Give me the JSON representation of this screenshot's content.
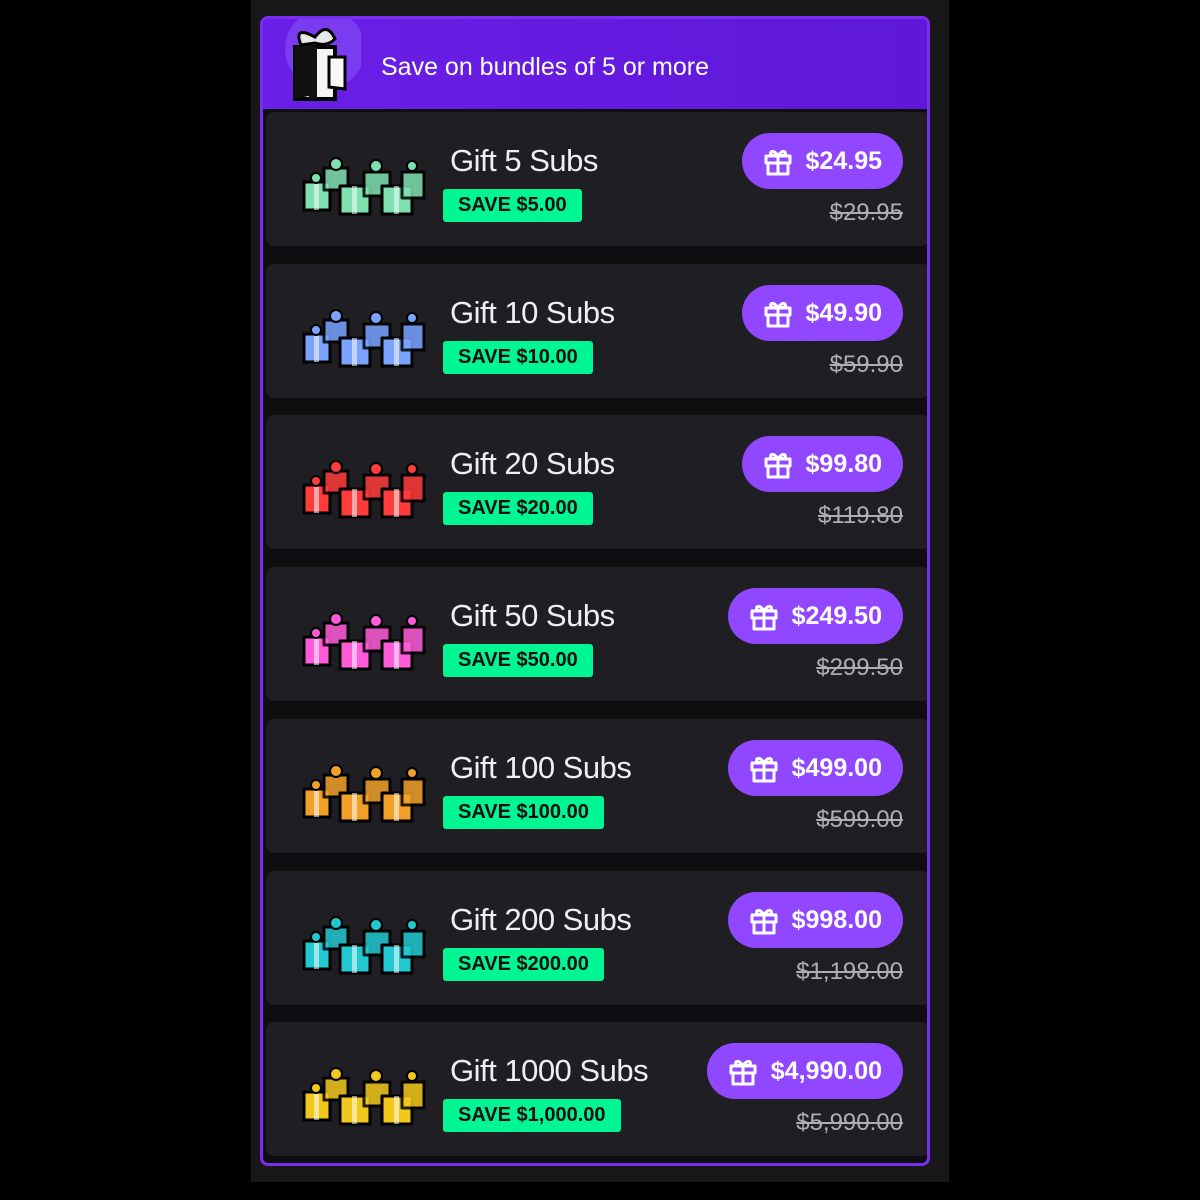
{
  "banner": {
    "text": "Save on bundles of 5 or more",
    "icon": "gift-box-icon"
  },
  "bundles": [
    {
      "title": "Gift 5 Subs",
      "save": "SAVE $5.00",
      "price": "$24.95",
      "old_price": "$29.95",
      "icon": "gift-pile-icon",
      "color": "#7fe0b0"
    },
    {
      "title": "Gift 10 Subs",
      "save": "SAVE $10.00",
      "price": "$49.90",
      "old_price": "$59.90",
      "icon": "gift-pile-icon",
      "color": "#7aa2ff"
    },
    {
      "title": "Gift 20 Subs",
      "save": "SAVE $20.00",
      "price": "$99.80",
      "old_price": "$119.80",
      "icon": "gift-pile-icon",
      "color": "#ff3b3b"
    },
    {
      "title": "Gift 50 Subs",
      "save": "SAVE $50.00",
      "price": "$249.50",
      "old_price": "$299.50",
      "icon": "gift-pile-icon",
      "color": "#ff5ad8"
    },
    {
      "title": "Gift 100 Subs",
      "save": "SAVE $100.00",
      "price": "$499.00",
      "old_price": "$599.00",
      "icon": "gift-pile-icon",
      "color": "#f0a028"
    },
    {
      "title": "Gift 200 Subs",
      "save": "SAVE $200.00",
      "price": "$998.00",
      "old_price": "$1,198.00",
      "icon": "gift-pile-icon",
      "color": "#22c8d0"
    },
    {
      "title": "Gift 1000 Subs",
      "save": "SAVE $1,000.00",
      "price": "$4,990.00",
      "old_price": "$5,990.00",
      "icon": "gift-pile-icon",
      "color": "#f2c81c"
    }
  ],
  "colors": {
    "accent": "#9147ff",
    "banner": "#6a1fe6",
    "save_badge": "#00f593",
    "row_bg": "#1f1f23"
  }
}
